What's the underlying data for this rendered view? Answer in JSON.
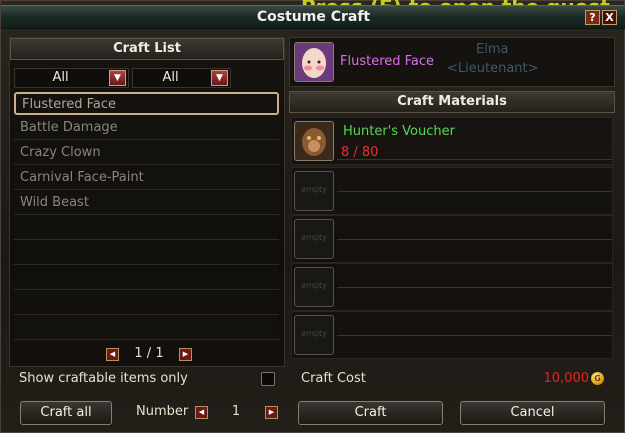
{
  "window": {
    "title": "Costume Craft",
    "help_label": "?",
    "close_label": "X"
  },
  "background": {
    "quest_hint": "Press (F) to open the quest",
    "npc_name": "Elma",
    "npc_title": "<Lieutenant>"
  },
  "craft_list": {
    "title": "Craft List",
    "filter1": "All",
    "filter2": "All",
    "items": [
      "Flustered Face",
      "Battle Damage",
      "Crazy Clown",
      "Carnival Face-Paint",
      "Wild Beast"
    ],
    "selected_index": 0,
    "page": "1 / 1",
    "craftable_only_label": "Show craftable items only",
    "craftable_only_checked": false
  },
  "selected": {
    "name": "Flustered Face"
  },
  "materials": {
    "title": "Craft Materials",
    "items": [
      {
        "name": "Hunter's Voucher",
        "count": "8 / 80"
      }
    ],
    "empty_label": "empty"
  },
  "cost": {
    "label": "Craft Cost",
    "value": "10,000"
  },
  "controls": {
    "craft_all_label": "Craft all",
    "number_label": "Number",
    "number_value": "1",
    "craft_label": "Craft",
    "cancel_label": "Cancel"
  },
  "colors": {
    "item_name": "#d870e8",
    "material_name": "#58d858",
    "insufficient": "#e83030"
  }
}
